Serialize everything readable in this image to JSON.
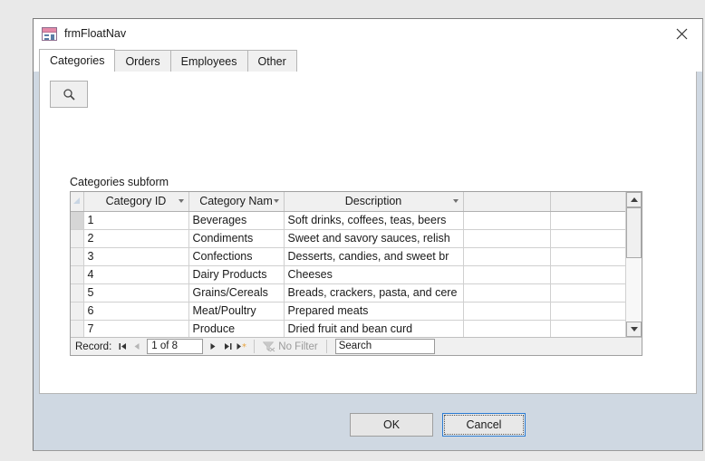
{
  "window": {
    "title": "frmFloatNav",
    "icon": "access-form-icon",
    "close_label": "✕"
  },
  "tabs": [
    {
      "label": "Categories",
      "active": true
    },
    {
      "label": "Orders",
      "active": false
    },
    {
      "label": "Employees",
      "active": false
    },
    {
      "label": "Other",
      "active": false
    }
  ],
  "toolbar": {
    "search_button_icon": "magnifier-icon"
  },
  "subform": {
    "label": "Categories subform",
    "columns": [
      {
        "header": "Category ID",
        "align": "left"
      },
      {
        "header": "Category Nam",
        "align": "left"
      },
      {
        "header": "Description",
        "align": "left"
      },
      {
        "header": "",
        "align": "left"
      },
      {
        "header": "",
        "align": "left"
      }
    ],
    "rows": [
      {
        "id": "1",
        "name": "Beverages",
        "description": "Soft drinks, coffees, teas, beers",
        "selected": true
      },
      {
        "id": "2",
        "name": "Condiments",
        "description": "Sweet and savory sauces, relish",
        "selected": false
      },
      {
        "id": "3",
        "name": "Confections",
        "description": "Desserts, candies, and sweet br",
        "selected": false
      },
      {
        "id": "4",
        "name": "Dairy Products",
        "description": "Cheeses",
        "selected": false
      },
      {
        "id": "5",
        "name": "Grains/Cereals",
        "description": "Breads, crackers, pasta, and cere",
        "selected": false
      },
      {
        "id": "6",
        "name": "Meat/Poultry",
        "description": "Prepared meats",
        "selected": false
      },
      {
        "id": "7",
        "name": "Produce",
        "description": "Dried fruit and bean curd",
        "selected": false
      }
    ],
    "record_nav": {
      "label": "Record:",
      "position": "1 of 8",
      "first_icon": "◀▐",
      "prev_icon": "◀",
      "next_icon": "▶",
      "last_icon": "▌▶",
      "new_icon": "▶✻",
      "filter_label": "No Filter",
      "search_value": "Search"
    }
  },
  "footer": {
    "ok_label": "OK",
    "cancel_label": "Cancel"
  },
  "colors": {
    "selection": "#a3cbeb",
    "dialog_background": "#cfd8e2",
    "page_background": "#e9e9e9",
    "focus_border": "#2b7cd3",
    "icon_accent": "#e489a8",
    "new_record_accent": "#e8a33d"
  }
}
